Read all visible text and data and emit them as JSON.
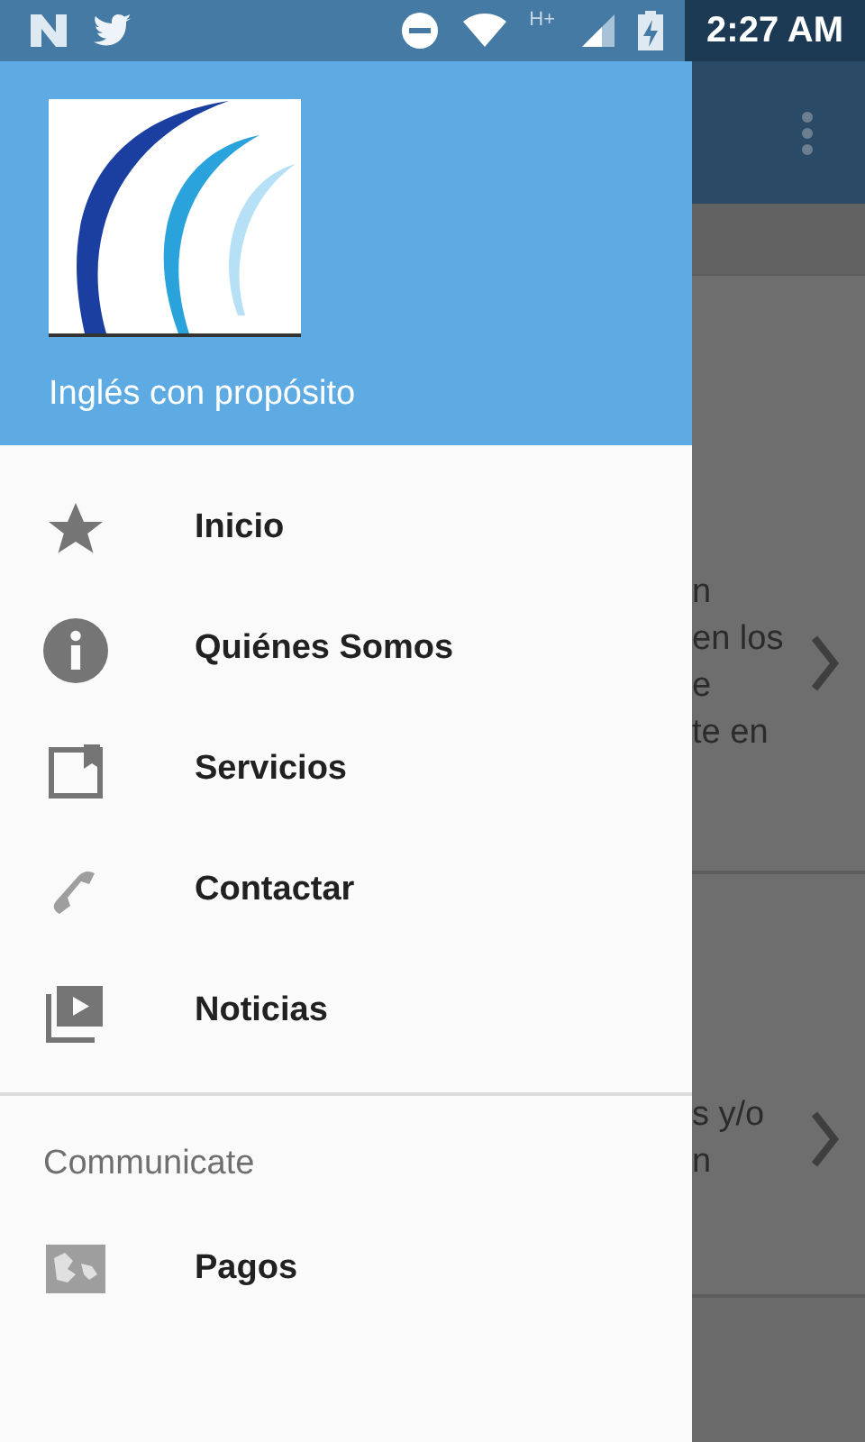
{
  "status_bar": {
    "time": "2:27 AM",
    "network": "H+"
  },
  "drawer": {
    "title": "Inglés con propósito",
    "items": [
      {
        "label": "Inicio"
      },
      {
        "label": "Quiénes Somos"
      },
      {
        "label": "Servicios"
      },
      {
        "label": "Contactar"
      },
      {
        "label": "Noticias"
      }
    ],
    "section": {
      "title": "Communicate",
      "items": [
        {
          "label": "Pagos"
        }
      ]
    }
  },
  "background": {
    "cards": [
      {
        "lines": [
          "n",
          "en los",
          "e",
          "te en"
        ]
      },
      {
        "lines": [
          "s y/o",
          "n"
        ]
      }
    ]
  }
}
